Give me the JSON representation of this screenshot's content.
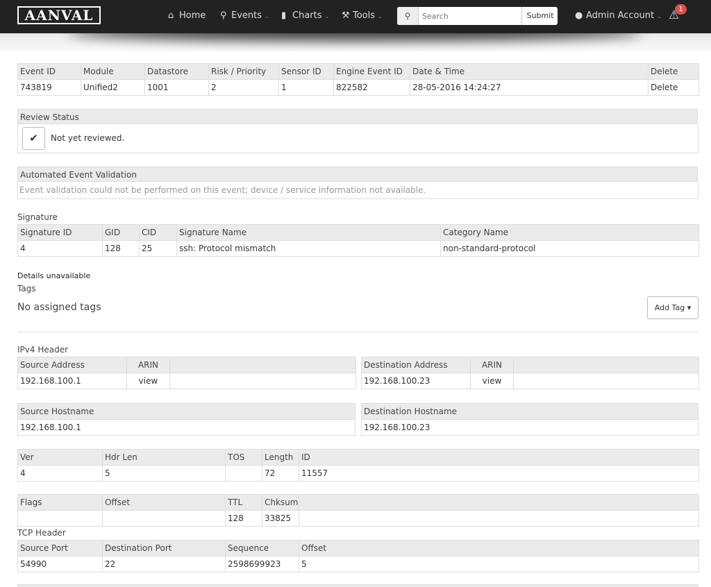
{
  "nav": {
    "logo": "AANVAL",
    "home": "Home",
    "events": "Events",
    "charts": "Charts",
    "tools": "Tools",
    "search_placeholder": "Search",
    "submit": "Submit",
    "account": "Admin Account",
    "alert_count": "1"
  },
  "event": {
    "headers": [
      "Event ID",
      "Module",
      "Datastore",
      "Risk / Priority",
      "Sensor ID",
      "Engine Event ID",
      "Date & Time",
      "Delete"
    ],
    "row": [
      "743819",
      "Unified2",
      "1001",
      "2",
      "1",
      "822582",
      "28-05-2016 14:24:27",
      "Delete"
    ]
  },
  "review": {
    "title": "Review Status",
    "text": "Not yet reviewed."
  },
  "validation": {
    "title": "Automated Event Validation",
    "text": "Event validation could not be performed on this event; device / service information not available."
  },
  "signature": {
    "label": "Signature",
    "headers": [
      "Signature ID",
      "GID",
      "CID",
      "Signature Name",
      "Category Name"
    ],
    "row": [
      "4",
      "128",
      "25",
      "ssh: Protocol mismatch",
      "non-standard-protocol"
    ]
  },
  "details": "Details unavailable",
  "tags": {
    "label": "Tags",
    "none": "No assigned tags",
    "add": "Add Tag"
  },
  "ipv4": {
    "label": "IPv4 Header",
    "src_headers": [
      "Source Address",
      "ARIN",
      ""
    ],
    "src_row": [
      "192.168.100.1",
      "view",
      ""
    ],
    "dst_headers": [
      "Destination Address",
      "ARIN",
      ""
    ],
    "dst_row": [
      "192.168.100.23",
      "view",
      ""
    ],
    "src_host_header": "Source Hostname",
    "src_host": "192.168.100.1",
    "dst_host_header": "Destination Hostname",
    "dst_host": "192.168.100.23",
    "fields1_headers": [
      "Ver",
      "Hdr Len",
      "TOS",
      "Length",
      "ID"
    ],
    "fields1_row": [
      "4",
      "5",
      "",
      "72",
      "11557"
    ],
    "fields2_headers": [
      "Flags",
      "Offset",
      "TTL",
      "Chksum",
      ""
    ],
    "fields2_row": [
      "",
      "",
      "128",
      "33825",
      ""
    ]
  },
  "tcp": {
    "label": "TCP Header",
    "headers": [
      "Source Port",
      "Destination Port",
      "Sequence",
      "Offset"
    ],
    "row": [
      "54990",
      "22",
      "2598699923",
      "5"
    ]
  }
}
